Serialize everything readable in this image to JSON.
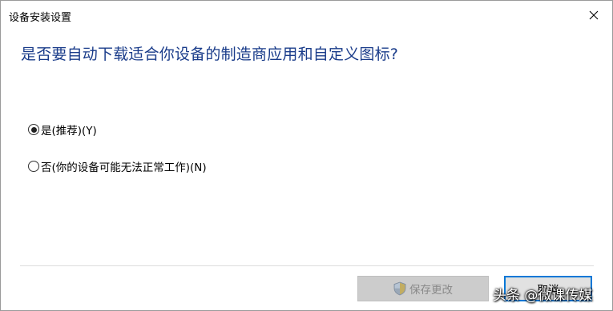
{
  "window": {
    "title": "设备安装设置"
  },
  "prompt": {
    "heading": "是否要自动下载适合你设备的制造商应用和自定义图标?"
  },
  "options": [
    {
      "label": "是(推荐)(Y)",
      "selected": true
    },
    {
      "label": "否(你的设备可能无法正常工作)(N)",
      "selected": false
    }
  ],
  "buttons": {
    "save_label": "保存更改",
    "save_enabled": false,
    "cancel_label": "取消"
  },
  "watermark": {
    "text": "头条 @微课传媒"
  },
  "colors": {
    "heading": "#1a3c8a",
    "focus_border": "#0078d7",
    "disabled_button": "#cccccc"
  }
}
